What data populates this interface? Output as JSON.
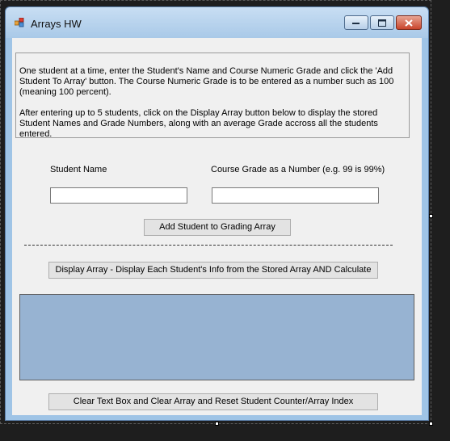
{
  "window": {
    "title": "Arrays HW",
    "minimize_icon": "minimize-icon",
    "maximize_icon": "maximize-icon",
    "close_icon": "close-icon"
  },
  "instructions": {
    "paragraph1": "One student at a time, enter the Student's Name and Course Numeric Grade and click the 'Add Student To Array' button. The Course Numeric Grade is to be entered as a number such as 100 (meaning 100 percent).",
    "paragraph2": "After entering up to 5 students, click on the Display Array button below to display the stored Student Names and Grade Numbers, along with an average Grade accross all the students entered."
  },
  "form": {
    "student_name_label": "Student Name",
    "course_grade_label": "Course Grade as a Number (e.g. 99 is 99%)",
    "student_name_value": "",
    "course_grade_value": ""
  },
  "buttons": {
    "add_student": "Add Student to Grading Array",
    "display_array": "Display Array - Display Each Student's Info from the Stored Array AND Calculate",
    "clear_reset": "Clear Text Box and Clear Array and Reset Student Counter/Array Index"
  },
  "output": {
    "text": ""
  },
  "colors": {
    "output_background": "#97b3d2",
    "client_background": "#f0f0f0",
    "window_frame": "#9fc4e6"
  }
}
